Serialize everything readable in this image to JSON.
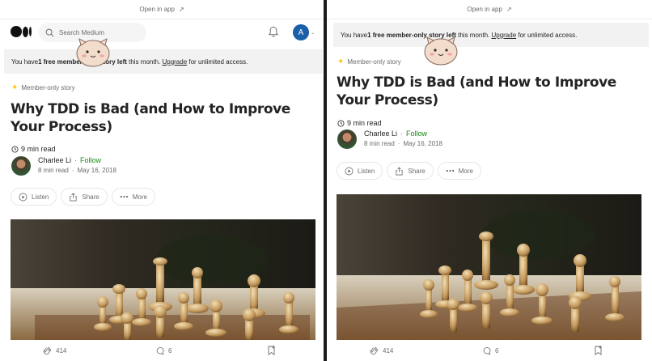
{
  "top_bar": {
    "open_in_app": "Open in app",
    "arrow": "↗"
  },
  "nav": {
    "search_placeholder": "Search Medium",
    "avatar_letter": "A",
    "avatar_caret": "⌄"
  },
  "banner": {
    "prefix": "You have ",
    "bold": "1 free member-only story left",
    "middle": " this month. ",
    "upgrade": "Upgrade",
    "suffix": " for unlimited access."
  },
  "article": {
    "member_star": "✦",
    "member_label": "Member-only story",
    "title": "Why TDD is Bad (and How to Improve Your Process)",
    "read_time": "9 min read",
    "author_name": "Charlee Li",
    "dot": "·",
    "follow": "Follow",
    "meta_read": "8 min read",
    "meta_date": "May 16, 2018"
  },
  "actions": {
    "listen": "Listen",
    "share": "Share",
    "more": "More"
  },
  "footer": {
    "claps": "414",
    "responses": "6"
  },
  "colors": {
    "accent_green": "#1a8917",
    "member_star": "#ffc017",
    "avatar_blue": "#1a5fa8",
    "banner_bg": "#f2f2f2"
  },
  "icons": [
    "medium-logo-icon",
    "search-icon",
    "bell-icon",
    "star-icon",
    "clock-icon",
    "play-icon",
    "share-icon",
    "more-icon",
    "clap-icon",
    "comment-icon",
    "bookmark-icon",
    "external-link-icon"
  ]
}
